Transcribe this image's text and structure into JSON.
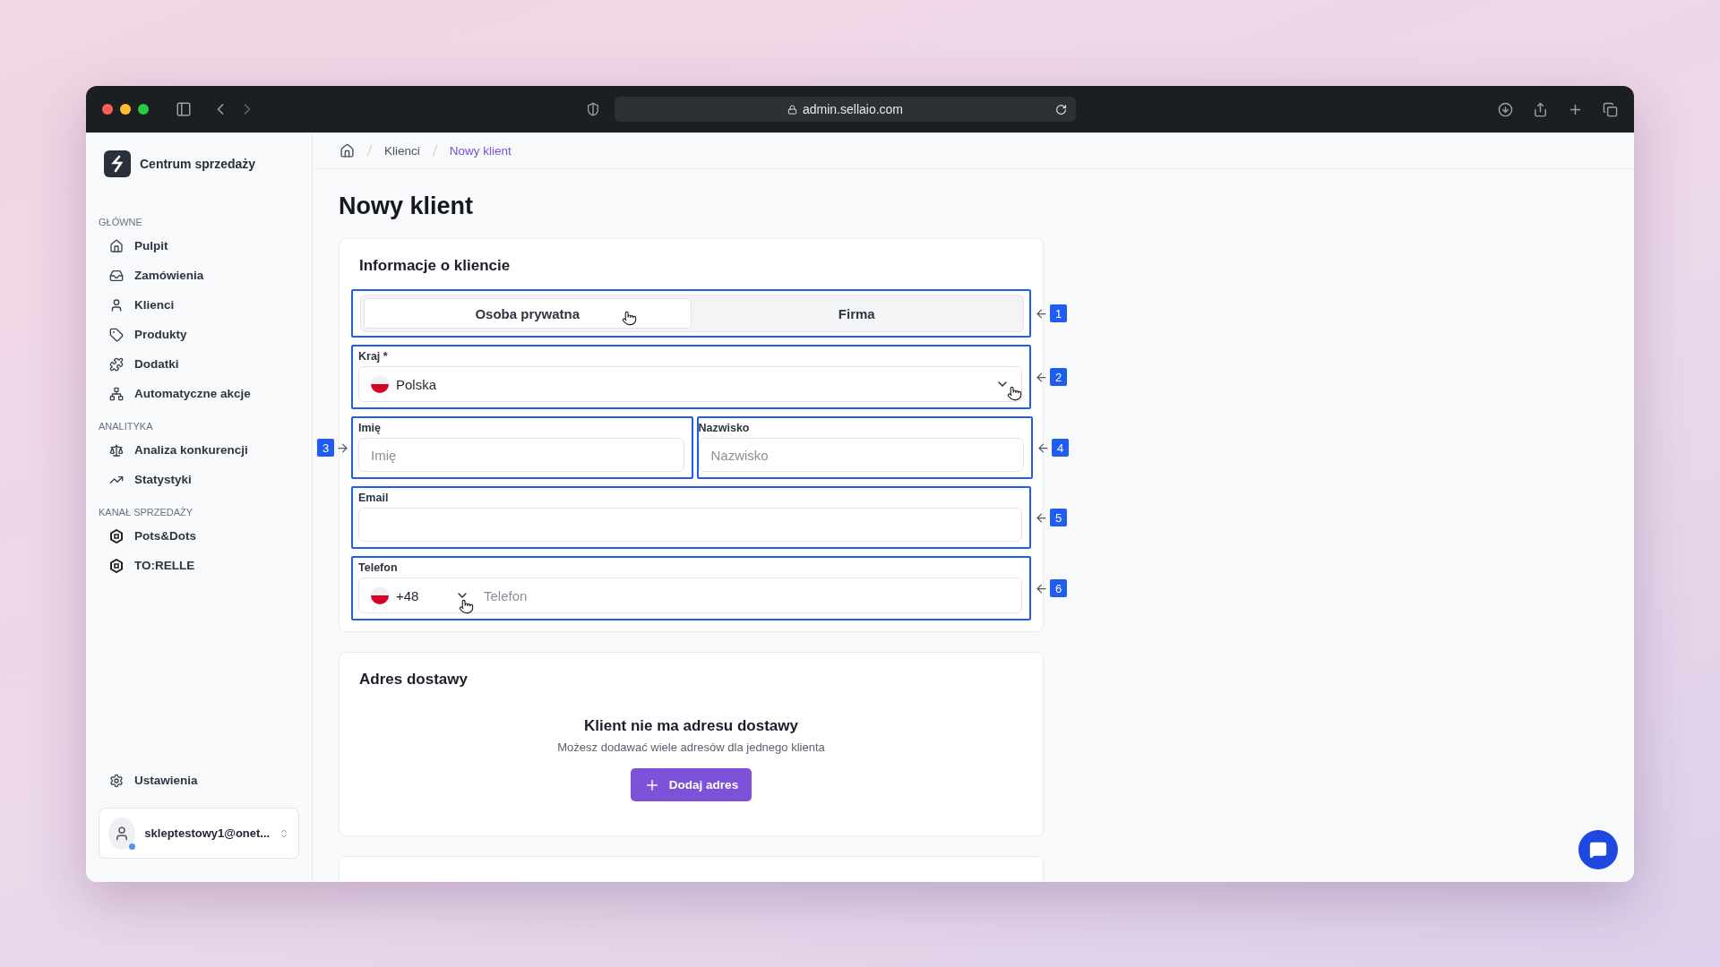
{
  "browser": {
    "url": "admin.sellaio.com"
  },
  "sidebar": {
    "brand": "Centrum sprzedaży",
    "sections": [
      {
        "heading": "GŁÓWNE",
        "items": [
          "Pulpit",
          "Zamówienia",
          "Klienci",
          "Produkty",
          "Dodatki",
          "Automatyczne akcje"
        ]
      },
      {
        "heading": "ANALITYKA",
        "items": [
          "Analiza konkurencji",
          "Statystyki"
        ]
      },
      {
        "heading": "KANAŁ SPRZEDAŻY",
        "items": [
          "Pots&Dots",
          "TO:RELLE"
        ]
      }
    ],
    "settings": "Ustawienia",
    "user": {
      "email": "skleptestowy1@onet...",
      "online": true
    }
  },
  "breadcrumbs": [
    {
      "label": "Klienci",
      "current": false
    },
    {
      "label": "Nowy klient",
      "current": true
    }
  ],
  "page_title": "Nowy klient",
  "client_info": {
    "title": "Informacje o kliencie",
    "customer_type": {
      "marker": {
        "number": "1",
        "kind": "right"
      },
      "options": [
        {
          "label": "Osoba prywatna",
          "selected": true
        },
        {
          "label": "Firma",
          "selected": false
        }
      ]
    },
    "country": {
      "marker": {
        "number": "2",
        "kind": "right"
      },
      "label": "Kraj *",
      "value": "Polska"
    },
    "first_name": {
      "marker": {
        "number": "3",
        "kind": "left"
      },
      "label": "Imię",
      "placeholder": "Imię"
    },
    "last_name": {
      "marker": {
        "number": "4",
        "kind": "right"
      },
      "label": "Nazwisko",
      "placeholder": "Nazwisko"
    },
    "email": {
      "marker": {
        "number": "5",
        "kind": "right"
      },
      "label": "Email"
    },
    "phone": {
      "marker": {
        "number": "6",
        "kind": "right"
      },
      "label": "Telefon",
      "code": "+48",
      "placeholder": "Telefon"
    }
  },
  "delivery": {
    "title": "Adres dostawy",
    "empty_title": "Klient nie ma adresu dostawy",
    "empty_text": "Możesz dodawać wiele adresów dla jednego klienta",
    "button": "Dodaj adres"
  }
}
